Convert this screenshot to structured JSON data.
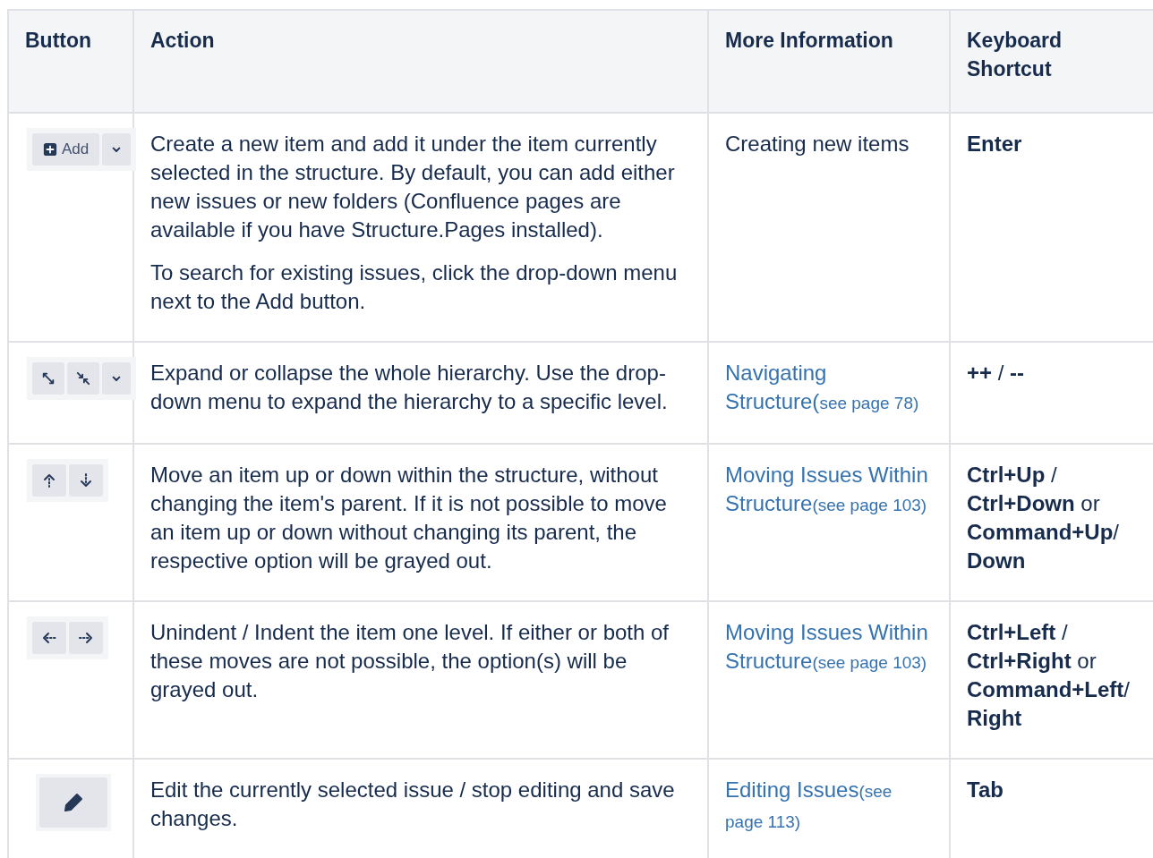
{
  "table": {
    "columns": [
      "Button",
      "Action",
      "More Information",
      "Keyboard Shortcut"
    ],
    "rows": [
      {
        "button": {
          "segments": [
            {
              "kind": "add",
              "label": "Add"
            },
            {
              "kind": "dropdown"
            }
          ]
        },
        "action": [
          "Create a new item and add it under the item currently selected in the structure. By default, you can add either new issues or new folders (Confluence pages are available if you have Structure.Pages installed).",
          "To search for existing issues, click the drop-down menu next to the Add button."
        ],
        "info": {
          "kind": "text",
          "text": "Creating new items"
        },
        "shortcut": "**Enter**"
      },
      {
        "button": {
          "segments": [
            {
              "kind": "expand"
            },
            {
              "kind": "collapse"
            },
            {
              "kind": "dropdown"
            }
          ]
        },
        "action": [
          "Expand or collapse the whole hierarchy. Use the drop-down menu to expand the hierarchy to a specific level."
        ],
        "info": {
          "kind": "link",
          "text": "Navigating Structure(",
          "ref": "see page 78)"
        },
        "shortcut": "**++** / **--**"
      },
      {
        "button": {
          "segments": [
            {
              "kind": "up"
            },
            {
              "kind": "down"
            }
          ]
        },
        "action": [
          "Move an item up or down within the structure, without changing the item's parent. If it is not possible to move an item up or down without changing its parent, the respective option will be grayed out."
        ],
        "info": {
          "kind": "link",
          "text": "Moving Issues Within Structure",
          "ref": "(see page 103)"
        },
        "shortcut": "**Ctrl+Up** / **Ctrl+Down** or **Command+Up**/ **Down**"
      },
      {
        "button": {
          "segments": [
            {
              "kind": "unindent"
            },
            {
              "kind": "indent"
            }
          ]
        },
        "action": [
          "Unindent / Indent the item one level. If either or both of these moves are not possible, the option(s) will be grayed out."
        ],
        "info": {
          "kind": "link",
          "text": "Moving Issues Within Structure",
          "ref": "(see page 103)"
        },
        "shortcut": "**Ctrl+Left** / **Ctrl+Right** or **Command+Left**/ **Right**"
      },
      {
        "button": {
          "segments": [
            {
              "kind": "edit"
            }
          ]
        },
        "action": [
          "Edit the currently selected issue / stop editing and save changes."
        ],
        "info": {
          "kind": "link",
          "text": "Editing Issues",
          "ref": "(see page 113)"
        },
        "shortcut": "**Tab**"
      }
    ]
  }
}
